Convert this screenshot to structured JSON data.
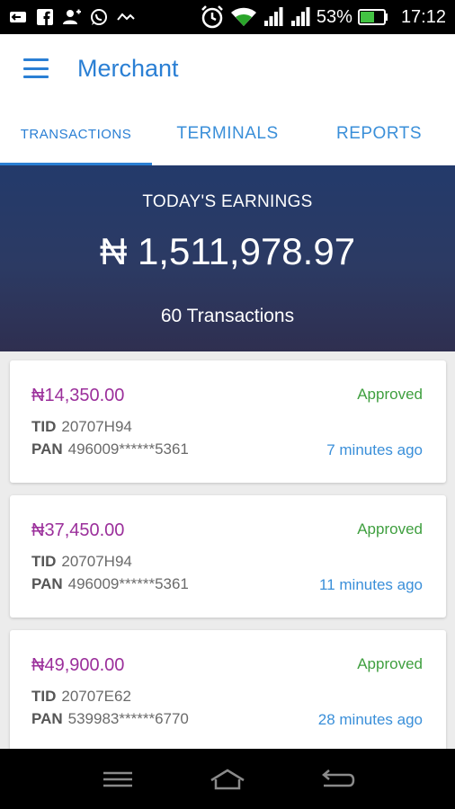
{
  "status_bar": {
    "battery": "53%",
    "time": "17:12",
    "icons": [
      "notification-icon",
      "facebook-icon",
      "add-contact-icon",
      "whatsapp-icon",
      "signal-activity-icon",
      "alarm-icon",
      "wifi-icon",
      "cell-signal-icon",
      "cell-signal-icon",
      "battery-icon"
    ]
  },
  "app_bar": {
    "title": "Merchant"
  },
  "tabs": [
    {
      "label": "TRANSACTIONS",
      "active": true
    },
    {
      "label": "TERMINALS",
      "active": false
    },
    {
      "label": "REPORTS",
      "active": false
    }
  ],
  "earnings": {
    "label": "TODAY'S EARNINGS",
    "amount": "₦ 1,511,978.97",
    "count": "60 Transactions"
  },
  "transactions": [
    {
      "amount": "₦14,350.00",
      "status": "Approved",
      "tid_label": "TID",
      "tid": "20707H94",
      "pan_label": "PAN",
      "pan": "496009******5361",
      "time": "7 minutes ago"
    },
    {
      "amount": "₦37,450.00",
      "status": "Approved",
      "tid_label": "TID",
      "tid": "20707H94",
      "pan_label": "PAN",
      "pan": "496009******5361",
      "time": "11 minutes ago"
    },
    {
      "amount": "₦49,900.00",
      "status": "Approved",
      "tid_label": "TID",
      "tid": "20707E62",
      "pan_label": "PAN",
      "pan": "539983******6770",
      "time": "28 minutes ago"
    }
  ],
  "colors": {
    "accent": "#2a7fd4",
    "amount": "#9b2f9b",
    "approved": "#3f9f3f",
    "header_start": "#233a6b",
    "header_end": "#2f2f50"
  },
  "nav_bar": {
    "icons": [
      "menu-icon",
      "home-icon",
      "back-icon"
    ]
  }
}
